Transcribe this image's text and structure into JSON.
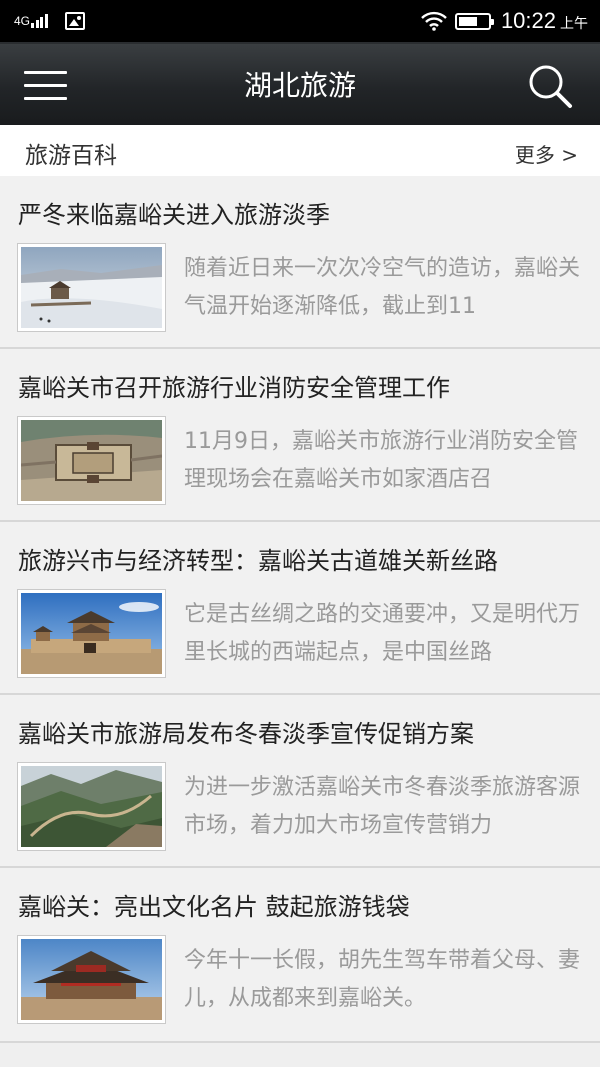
{
  "status_bar": {
    "network": "4G",
    "time": "10:22",
    "ampm": "上午",
    "icons": [
      "signal-icon",
      "photo-icon",
      "wifi-icon",
      "battery-icon"
    ]
  },
  "app_bar": {
    "title": "湖北旅游",
    "icons": [
      "menu-icon",
      "search-icon"
    ]
  },
  "section": {
    "title": "旅游百科",
    "more": "更多 >"
  },
  "articles": [
    {
      "title": "严冬来临嘉峪关进入旅游淡季",
      "summary": "随着近日来一次次冷空气的造访，嘉峪关气温开始逐渐降低，截止到11",
      "thumb": "snow-fortress"
    },
    {
      "title": "嘉峪关市召开旅游行业消防安全管理工作",
      "summary": "11月9日，嘉峪关市旅游行业消防安全管理现场会在嘉峪关市如家酒店召",
      "thumb": "aerial-fortress"
    },
    {
      "title": "旅游兴市与经济转型：嘉峪关古道雄关新丝路",
      "summary": "它是古丝绸之路的交通要冲，又是明代万里长城的西端起点，是中国丝路",
      "thumb": "gate-tower"
    },
    {
      "title": "嘉峪关市旅游局发布冬春淡季宣传促销方案",
      "summary": "为进一步激活嘉峪关市冬春淡季旅游客源市场，着力加大市场宣传营销力",
      "thumb": "great-wall-mountains"
    },
    {
      "title": "嘉峪关：亮出文化名片 鼓起旅游钱袋",
      "summary": "今年十一长假，胡先生驾车带着父母、妻儿，从成都来到嘉峪关。",
      "thumb": "tower-closeup"
    }
  ]
}
